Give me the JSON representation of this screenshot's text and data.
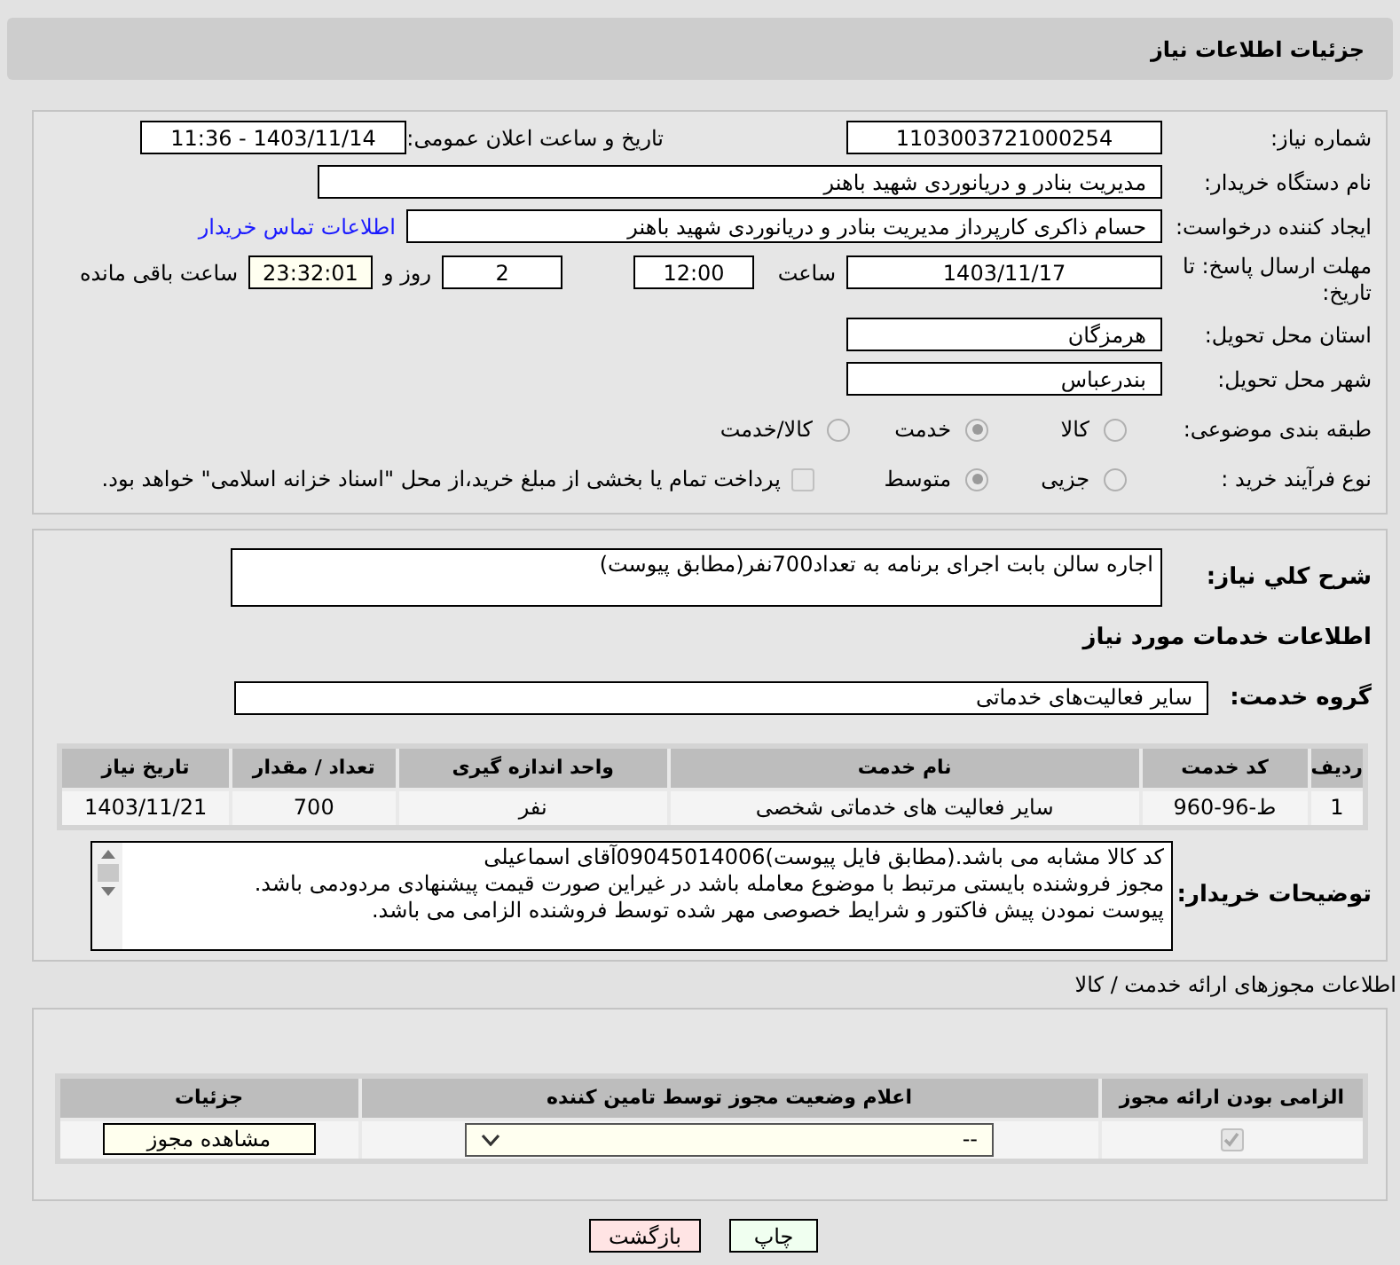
{
  "header": {
    "title": "جزئیات اطلاعات نیاز"
  },
  "need_number": {
    "label": "شماره نیاز:",
    "value": "1103003721000254"
  },
  "announce": {
    "label": "تاریخ و ساعت اعلان عمومی:",
    "value": "1403/11/14 - 11:36"
  },
  "buyer_org": {
    "label": "نام دستگاه خریدار:",
    "value": "مدیریت بنادر و دریانوردی شهید باهنر"
  },
  "requester": {
    "label": "ایجاد کننده درخواست:",
    "value": "حسام  ذاکری کارپرداز مدیریت بنادر و دریانوردی شهید باهنر",
    "link": "اطلاعات تماس خریدار"
  },
  "deadline": {
    "label": "مهلت ارسال پاسخ: تا تاریخ:",
    "date": "1403/11/17",
    "time_label": "ساعت",
    "time": "12:00",
    "days": "2",
    "days_label": "روز و",
    "remaining": "23:32:01",
    "remaining_label": "ساعت باقی مانده"
  },
  "province": {
    "label": "استان محل تحویل:",
    "value": "هرمزگان"
  },
  "city": {
    "label": "شهر محل تحویل:",
    "value": "بندرعباس"
  },
  "category": {
    "label": "طبقه بندی موضوعی:",
    "options": [
      {
        "label": "کالا",
        "selected": false
      },
      {
        "label": "خدمت",
        "selected": true
      },
      {
        "label": "کالا/خدمت",
        "selected": false
      }
    ]
  },
  "process": {
    "label": "نوع فرآیند خرید :",
    "options": [
      {
        "label": "جزیی",
        "selected": false
      },
      {
        "label": "متوسط",
        "selected": true
      }
    ],
    "payment": {
      "label": "پرداخت تمام یا بخشی از مبلغ خرید،از محل \"اسناد خزانه اسلامی\" خواهد بود.",
      "checked": false
    }
  },
  "summary": {
    "label": "شرح کلي نياز:",
    "value": "اجاره سالن بابت اجرای برنامه به تعداد700نفر(مطابق پیوست)"
  },
  "services_title": "اطلاعات خدمات مورد نیاز",
  "service_group": {
    "label": "گروه خدمت:",
    "value": "سایر فعالیت‌های خدماتی"
  },
  "services_table": {
    "columns": [
      "ردیف",
      "کد خدمت",
      "نام خدمت",
      "واحد اندازه گیری",
      "تعداد / مقدار",
      "تاریخ نیاز"
    ],
    "rows": [
      [
        "1",
        "ط-96-960",
        "سایر فعالیت های خدماتی شخصی",
        "نفر",
        "700",
        "1403/11/21"
      ]
    ]
  },
  "buyer_notes": {
    "label": "توضیحات خریدار:",
    "lines": [
      "کد کالا مشابه می باشد.(مطابق فایل پیوست)09045014006آقای اسماعیلی",
      "مجوز فروشنده بایستی مرتبط با موضوع معامله باشد در غیراین صورت قیمت پیشنهادی مردودمی باشد.",
      "پیوست نمودن پیش فاکتور و شرایط خصوصی مهر شده توسط فروشنده الزامی می باشد."
    ]
  },
  "licenses_title": "اطلاعات مجوزهای ارائه خدمت / کالا",
  "license_table": {
    "columns": [
      "الزامی بودن ارائه مجوز",
      "اعلام وضعیت مجوز توسط تامین کننده",
      "جزئیات"
    ],
    "rows": [
      {
        "required": true,
        "status": "--",
        "details": "مشاهده مجوز"
      }
    ]
  },
  "buttons": [
    {
      "label": "چاپ",
      "kind": "print"
    },
    {
      "label": "بازگشت",
      "kind": "back"
    }
  ]
}
